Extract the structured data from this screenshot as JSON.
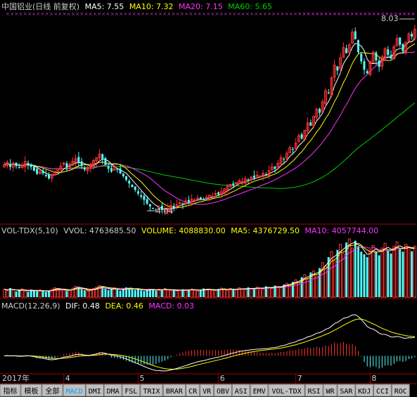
{
  "colors": {
    "bg": "#000000",
    "up": "#ff3333",
    "down": "#54ffff",
    "white": "#ffffff",
    "yellow": "#ffff00",
    "magenta": "#ff33ff",
    "green": "#00cc00",
    "axis": "#a00000",
    "tab_bg": "#c0c0c0",
    "tab_active_fg": "#00a0ff",
    "text": "#cccccc"
  },
  "price_panel": {
    "name": "中国铝业(日线 前复权)",
    "ma5_label": "MA5: 7.55",
    "ma10_label": "MA10: 7.32",
    "ma20_label": "MA20: 7.15",
    "ma60_label": "MA60: 5.65",
    "high_annotation": "8.03",
    "low_annotation": "4.04"
  },
  "volume_panel": {
    "name": "VOL-TDX(5,10)",
    "vvol_label": "VVOL: 4763685.50",
    "volume_label": "VOLUME: 4088830.00",
    "ma5_label": "MA5: 4376729.50",
    "ma10_label": "MA10: 4057744.00"
  },
  "macd_panel": {
    "name": "MACD(12,26,9)",
    "dif_label": "DIF: 0.48",
    "dea_label": "DEA: 0.46",
    "macd_label": "MACD: 0.03"
  },
  "time_axis": {
    "year_label": "2017年",
    "months": [
      "4",
      "5",
      "6",
      "7",
      "8"
    ]
  },
  "tabs": [
    "指标",
    "模板",
    "全部",
    "MACD",
    "DMI",
    "DMA",
    "FSL",
    "TRIX",
    "BRAR",
    "CR",
    "VR",
    "OBV",
    "ASI",
    "EMV",
    "VOL-TDX",
    "RSI",
    "WR",
    "SAR",
    "KDJ",
    "CCI",
    "ROC"
  ],
  "active_tab": "MACD",
  "chart_data": [
    {
      "type": "candlestick",
      "title": "中国铝业(日线 前复权)",
      "series": [
        {
          "name": "MA5",
          "last": 7.55
        },
        {
          "name": "MA10",
          "last": 7.32
        },
        {
          "name": "MA20",
          "last": 7.15
        },
        {
          "name": "MA60",
          "last": 5.65
        }
      ],
      "annotations": [
        {
          "text": "8.03",
          "value": 8.03
        },
        {
          "text": "4.04",
          "value": 4.04
        }
      ],
      "ylim": [
        3.8,
        8.3
      ],
      "close": [
        5.05,
        5.1,
        5.0,
        5.08,
        5.02,
        4.98,
        5.04,
        5.12,
        5.06,
        5.0,
        4.92,
        4.85,
        4.9,
        4.86,
        4.8,
        4.75,
        4.82,
        4.9,
        4.96,
        5.02,
        5.08,
        5.0,
        5.06,
        5.12,
        5.18,
        5.1,
        5.02,
        4.94,
        4.98,
        5.06,
        5.14,
        5.2,
        5.28,
        5.16,
        5.04,
        4.96,
        4.9,
        5.0,
        4.94,
        4.86,
        4.8,
        4.72,
        4.64,
        4.56,
        4.5,
        4.42,
        4.35,
        4.28,
        4.2,
        4.14,
        4.1,
        4.08,
        4.12,
        4.06,
        4.04,
        4.1,
        4.16,
        4.12,
        4.18,
        4.22,
        4.2,
        4.26,
        4.24,
        4.3,
        4.28,
        4.32,
        4.3,
        4.28,
        4.34,
        4.38,
        4.36,
        4.42,
        4.4,
        4.46,
        4.52,
        4.58,
        4.62,
        4.6,
        4.66,
        4.7,
        4.68,
        4.74,
        4.72,
        4.78,
        4.76,
        4.82,
        4.8,
        4.86,
        4.84,
        4.92,
        5.0,
        4.96,
        5.08,
        5.2,
        5.16,
        5.3,
        5.42,
        5.38,
        5.52,
        5.68,
        5.62,
        5.8,
        5.96,
        5.9,
        6.1,
        6.26,
        6.18,
        6.42,
        6.66,
        6.6,
        6.94,
        7.22,
        7.1,
        7.38,
        7.6,
        7.48,
        7.66,
        7.94,
        7.78,
        7.5,
        7.3,
        7.12,
        7.04,
        7.3,
        7.5,
        7.32,
        7.18,
        7.4,
        7.58,
        7.44,
        7.36,
        7.62,
        7.8,
        7.66,
        7.52,
        7.72,
        7.9,
        7.84,
        8.0
      ],
      "volume": [
        22,
        18,
        25,
        20,
        16,
        19,
        23,
        17,
        15,
        21,
        18,
        16,
        20,
        17,
        15,
        18,
        22,
        26,
        24,
        19,
        21,
        17,
        20,
        25,
        30,
        27,
        22,
        19,
        17,
        21,
        24,
        28,
        32,
        29,
        24,
        20,
        22,
        26,
        21,
        18,
        23,
        27,
        25,
        22,
        20,
        24,
        19,
        17,
        21,
        23,
        20,
        18,
        22,
        19,
        24,
        20,
        18,
        21,
        17,
        19,
        22,
        18,
        20,
        23,
        19,
        17,
        21,
        24,
        20,
        22,
        19,
        18,
        23,
        25,
        21,
        19,
        24,
        22,
        20,
        26,
        23,
        21,
        27,
        24,
        22,
        28,
        25,
        23,
        30,
        27,
        24,
        32,
        29,
        26,
        35,
        38,
        33,
        42,
        48,
        40,
        55,
        62,
        50,
        68,
        72,
        58,
        80,
        95,
        85,
        110,
        125,
        100,
        130,
        145,
        120,
        150,
        160,
        135,
        155,
        140,
        125,
        118,
        110,
        130,
        142,
        125,
        115,
        135,
        148,
        128,
        120,
        140,
        152,
        132,
        125,
        145,
        138,
        126,
        140
      ]
    },
    {
      "type": "line",
      "title": "MACD(12,26,9)",
      "series": [
        {
          "name": "DIF",
          "last": 0.48
        },
        {
          "name": "DEA",
          "last": 0.46
        },
        {
          "name": "MACD",
          "last": 0.03
        }
      ]
    }
  ]
}
